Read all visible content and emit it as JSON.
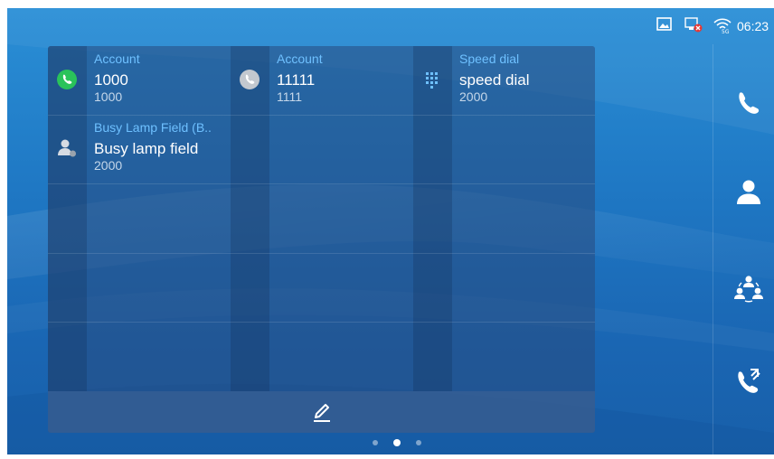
{
  "status_bar": {
    "time": "06:23",
    "icons": [
      "image-icon",
      "network-error-icon",
      "wifi-5g-icon"
    ]
  },
  "panel": {
    "cells": [
      {
        "type_label": "Account",
        "name": "1000",
        "number": "1000",
        "icon": "phone-green-icon"
      },
      {
        "type_label": "Account",
        "name": "11111",
        "number": "1111",
        "icon": "phone-gray-icon"
      },
      {
        "type_label": "Speed dial",
        "name": "speed dial",
        "number": "2000",
        "icon": "keypad-icon"
      },
      {
        "type_label": "Busy Lamp Field (B..",
        "name": "Busy lamp field",
        "number": "2000",
        "icon": "blf-contact-icon"
      }
    ],
    "edit_icon": "edit-pencil-icon"
  },
  "pagination": {
    "pages": 3,
    "current": 2
  },
  "dock": {
    "items": [
      "phone-icon",
      "contacts-icon",
      "conference-icon",
      "call-history-icon"
    ]
  },
  "colors": {
    "label_blue": "#6ec0ff",
    "accent_green": "#2ac35a",
    "background_blue": "#1f78c4"
  }
}
